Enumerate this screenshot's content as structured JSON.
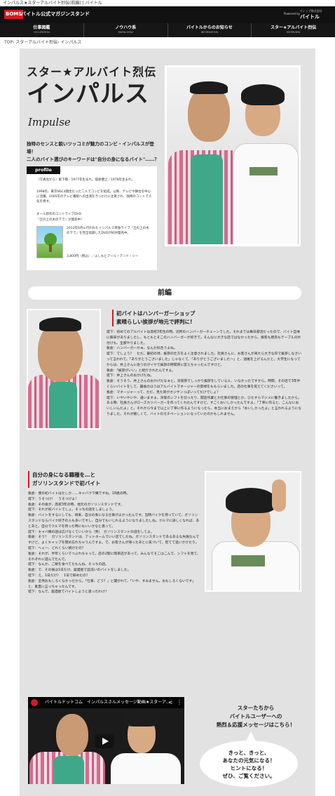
{
  "browser": {
    "title": "インパルス★スターアルバイト烈伝(前編) | バイトル"
  },
  "header": {
    "logo": "BOMS",
    "site_title": "バイトル公式マガジンスタンド",
    "powered_by": "Powered by",
    "brand_small": "ディップ株式会社",
    "brand": "バイトル"
  },
  "nav": [
    {
      "label": "仕事図鑑",
      "sub": "OCCUPATION"
    },
    {
      "label": "ノウハウ系",
      "sub": "KNOW-HOW"
    },
    {
      "label": "バイトルからのお知らせ",
      "sub": "INFORMATION"
    },
    {
      "label": "スター★アルバイト烈伝",
      "sub": "INTERVIEW"
    }
  ],
  "breadcrumb": "TOP› スターアルバイト烈伝› インパルス",
  "article": {
    "title": "スター★アルバイト烈伝",
    "name": "インパルス",
    "script": "Impulse",
    "lead_1": "独特のセンスと鋭いツッコミが魅力のコンビ・インパルスが登場！",
    "lead_2": "二人のバイト選びのキーワードは\"自分の身になるバイト\"……？"
  },
  "profile": {
    "tag": "profile",
    "members": "（写真左から）板下敬／1977年生まれ。堤倉健之／1978年生まれ。",
    "history": "1998年、東京NSC4期生だった二人でコンビを結成。以降、テレビや舞台を中心に活躍。2005年のテレビ番組への出演をきっかけに注目され、独特のコントで人気を博す。",
    "dvd_label": "オール新作のコントライブDVD",
    "dvd_title": "『丘の上の木の下で』が発売中！",
    "dvd_desc": "2012年6月に行われたインパルス単独ライブ『丘の上の木の下で』を完全収録したDVDが好評発売中。",
    "dvd_price": "3,800円（税込）／よしもとアール・アンド・シー"
  },
  "section": {
    "title": "前編"
  },
  "interview1": {
    "heading_1": "初バイトはハンバーガーショップ",
    "heading_2": "素晴らしい挨拶が地元で評判に!",
    "lines": [
      "堤下：初めてのアルバイトは高校3年生の時。近所のハンバーガーチェーンでした。それまでは毎日部活だったので、バイト自体に興味がありましたし、もともとそこのハンバーガーが好きで。そんなに大きな店ではなかったから、接客も厨房もテーブルの片付けも、全部やりました。",
      "板倉：ハンバーガーかぁ。なんか似合うよね。",
      "堤下：でしょう？　ただ、最初の頃、挨拶の仕方をよく注意されました。社員さんに、お客さんが来たら大きな声で挨拶しなさいって言われて。「ありがとうございました」じゃなくて、「ありがとうございました〜」と、語尾を上げるんだと。大学生になってからは、井上さんに会うのがイヤで挨拶の時間帯に変えちゃったんですけど。",
      "板倉：「挨拶がいい」と紹介されたんですよ。",
      "堤下：井上さんのおかげだね。",
      "板倉：そうそう、井上さんのおかげだなぁと。深夜帯でしっかり挨拶をしている人、いなかったですから。時間、その店で3年半くらいバイトをして、最後のほうはアルバイトマネージャーの貫禄をももらいました。店の仕事を覚えてくださいって。",
      "板倉：マネージャーって、ただ、見た目がオジサンっぽいってだけでしょ？",
      "堤下：いやいやいや、違いますよ。深夜のシフトを切ったり、開店作業とか仕事の管理とか、ひたすらマジメに働きましたから。ある時、社員さんがローズカツバーガーを作ってくれたんですけど、すごくおいしかったんですよ。「丁寧に作ると、こんなにおいしいんだよ」と。それから今まで以上に丁寧に作るようになったら、本当におまえから「おいしかったよ」と言われるようになりました。それが嬉しくて、バイトのモチベーションになっていたのかもしれません。"
    ]
  },
  "interview2": {
    "heading_1": "自分の身になる職種を…と",
    "heading_2": "ガソリンスタンドで初バイト",
    "lines": [
      "板倉：僕の初バイトはたしか……キャバクラ嬢ですね。16歳の時。",
      "堤下：うそつけ！　うそつけよ！",
      "板倉：その後が、高校3年の時、地元のガソリンスタンドです。",
      "堤下：それが初バイトでしょ。そっちの話をしましょう。",
      "板倉：バイトをするにしても、将来、自分の身になる仕事がよかったんです。当時バイクを持っていて、ガソリンスタンドならバイク好きの人も多いですし、自分でもいじれるようになりましたしね。クルマに詳しくなれば、あとあと、自分でクルマを持った時にもいいかなと思って。",
      "堤下：キャバ嬢の話は広げなくていいから（笑）　ガソリンスタンドの話をしてよ。",
      "板倉：そう？　ガソリンスタンドは、アットホームでいい店でしたね。ガソリンスタンドであるあるな失敗なんですけど、よくキャップを閉め忘れちゃうんですよ。で、お客さんが帰ったあとに気づいて、慌てて追いかけたり。",
      "堤下：へぇ〜、どれくらい続けたの？",
      "板倉：それが、半年くらいでつぶれちゃって。店の2階に喫茶店があって、みんなでそこはこんで、シフトを見て、それぞれに遊んでたんで。",
      "堤下：なんか、ご飯を食べてたもんね、そっちの話。",
      "板倉：で、その後は1日だけ、居酒屋で皿洗いのバイトをしました。",
      "堤下：え、1日だけ？　1日で辞めたの？",
      "板倉：全然おもしろくなかったから。「仕事、どう？」と聞かれて、「いや、すみません。おもしろくないです」と、素直に言っちゃったんです。",
      "堤下：なんで、居酒屋でバイトしようと思ったわけ？",
      "板倉：居酒屋って、かわいい店員さんがいそうでしょ。おもしろそうだし、楽しい仲間ができそうだなって。でも、実際、厨房は野郎ばっかり。大誤算でしたね。"
    ]
  },
  "video": {
    "title": "バイトルドットコム　インパルスさんメッセージ動画★スターア..."
  },
  "message": {
    "title_1": "スターたちから",
    "title_2": "バイトルユーザーへの",
    "title_3": "熱烈＆応援メッセージはこちら！",
    "bubble_1": "きっと、きっと、",
    "bubble_2": "あなたの元気になる！",
    "bubble_3": "ヒントになる！",
    "bubble_4": "ぜひ、ご覧ください。"
  },
  "colors": {
    "accent": "#d71920",
    "nav_bg": "#111111",
    "panel_bg": "#e2e2e2"
  }
}
